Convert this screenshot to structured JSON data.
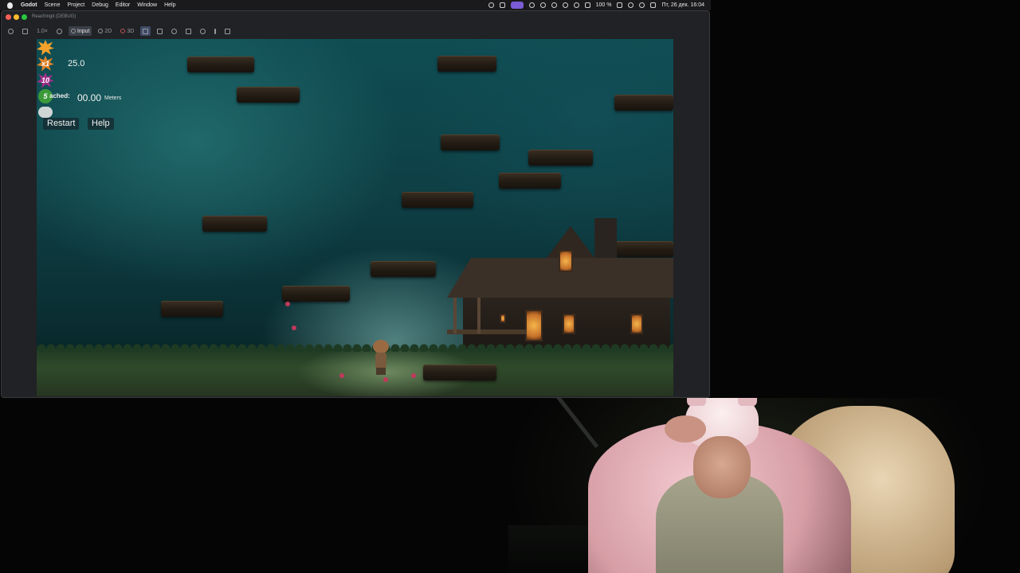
{
  "menubar": {
    "items": [
      "Godot",
      "Scene",
      "Project",
      "Debug",
      "Editor",
      "Window",
      "Help"
    ],
    "battery": "100 %",
    "datetime": "Пт, 26 дек.  16:04"
  },
  "window": {
    "title": "Reachingit (DEBUG)"
  },
  "toolbar": {
    "zoom": "1.0×",
    "input_label": "Input",
    "mode_2d": "2D",
    "mode_3d": "3D"
  },
  "hud": {
    "value": "25.0",
    "icon_labels": [
      "x1",
      "10",
      "5"
    ],
    "reached_label": "ached:",
    "distance": "00.00",
    "distance_unit": "Meters",
    "restart_label": "Restart",
    "help_label": "Help"
  },
  "colors": {
    "accent": "#7b5cd6",
    "sky": "#0f4d53",
    "window_bg": "#202225"
  },
  "icons": {
    "apple": "apple-icon",
    "burst_orange": "burst-icon",
    "burst_purple": "burst-purple-icon",
    "badge_green": "green-badge-icon",
    "cloud": "cloud-icon"
  }
}
